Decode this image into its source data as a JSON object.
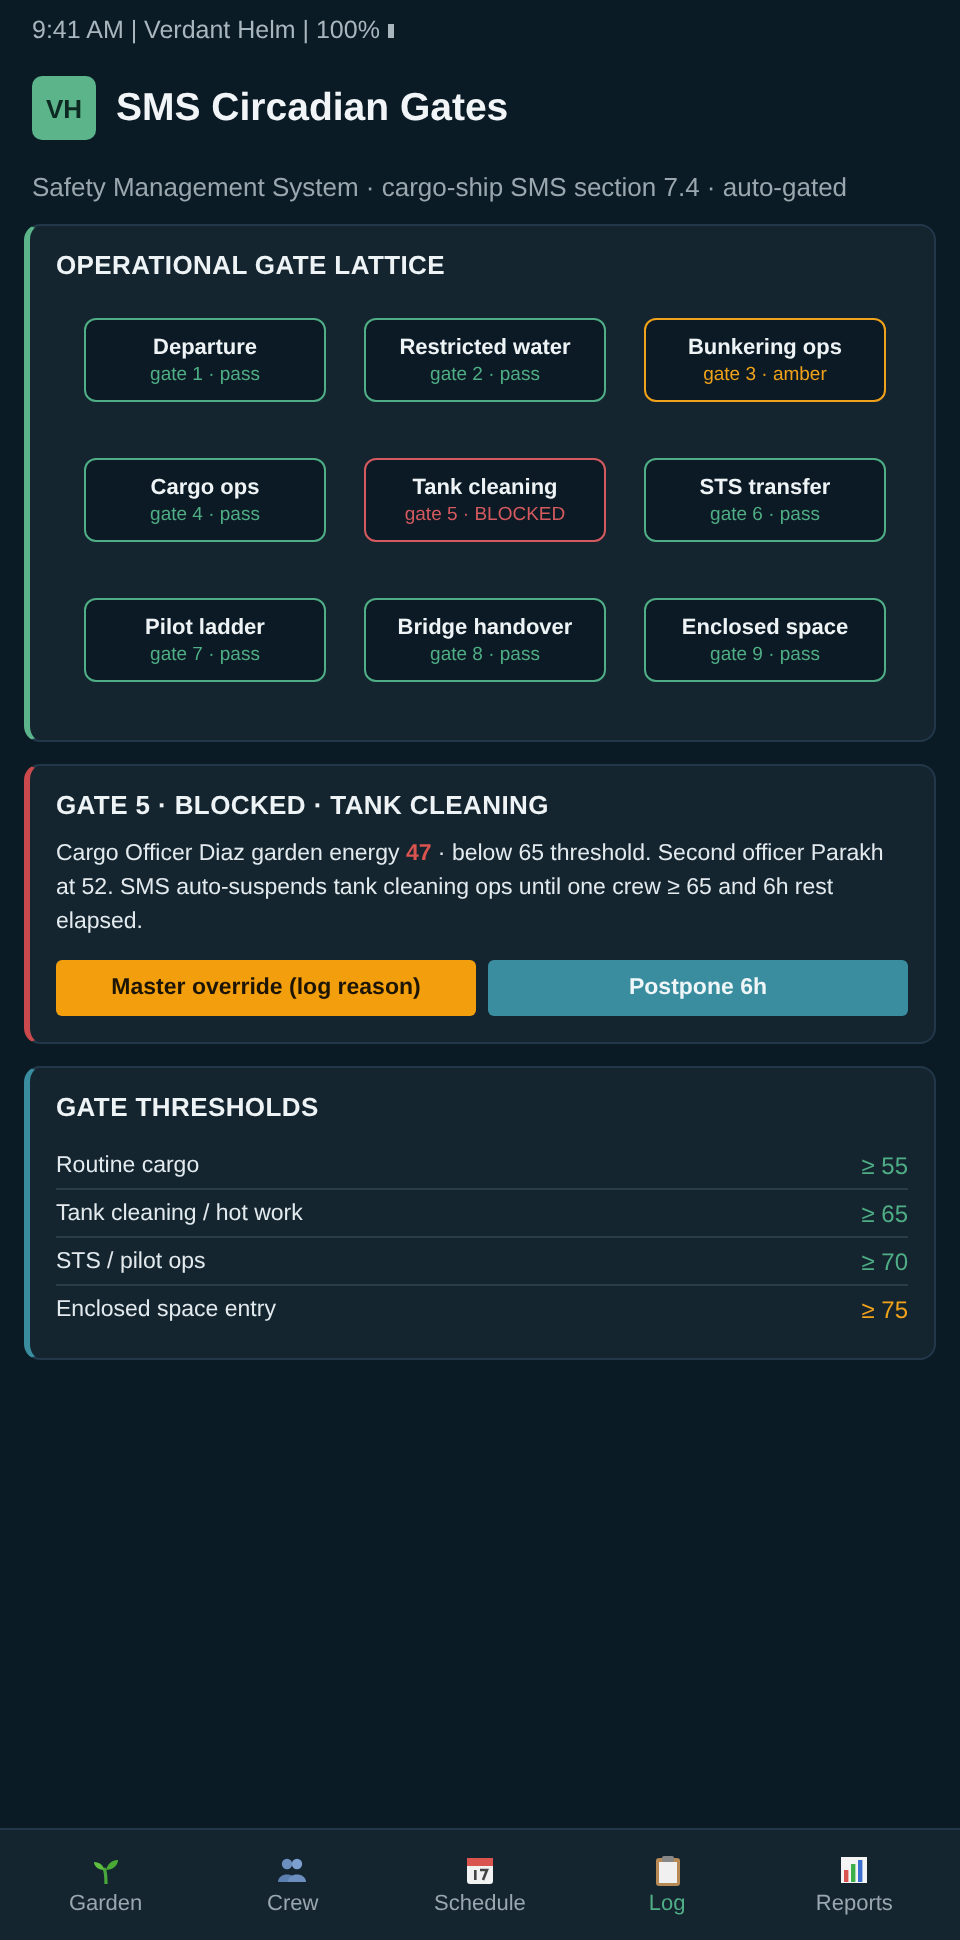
{
  "status_bar": {
    "text": "9:41 AM | Verdant Helm | 100%"
  },
  "header": {
    "logo": "VH",
    "title": "SMS Circadian Gates",
    "subtitle": "Safety Management System · cargo-ship SMS section 7.4 · auto-gated"
  },
  "lattice": {
    "title": "OPERATIONAL GATE LATTICE",
    "gates": [
      {
        "name": "Departure",
        "caption": "gate 1 · pass",
        "color": "#4fae85"
      },
      {
        "name": "Restricted water",
        "caption": "gate 2 · pass",
        "color": "#4fae85"
      },
      {
        "name": "Bunkering ops",
        "caption": "gate 3 · amber",
        "color": "#f0a21a"
      },
      {
        "name": "Cargo ops",
        "caption": "gate 4 · pass",
        "color": "#4fae85"
      },
      {
        "name": "Tank cleaning",
        "caption": "gate 5 · BLOCKED",
        "color": "#d45a5f"
      },
      {
        "name": "STS transfer",
        "caption": "gate 6 · pass",
        "color": "#4fae85"
      },
      {
        "name": "Pilot ladder",
        "caption": "gate 7 · pass",
        "color": "#4fae85"
      },
      {
        "name": "Bridge handover",
        "caption": "gate 8 · pass",
        "color": "#4fae85"
      },
      {
        "name": "Enclosed space",
        "caption": "gate 9 · pass",
        "color": "#4fae85"
      }
    ]
  },
  "alert": {
    "title": "GATE 5 · BLOCKED · TANK CLEANING",
    "body": "Cargo Officer Diaz garden energy **47** · below 65 threshold. Second officer Parakh at 52. SMS auto-suspends tank cleaning ops until one crew ≥ 65 and 6h rest elapsed.",
    "buttons": [
      {
        "label": "Master override (log reason)",
        "kind": "warning"
      },
      {
        "label": "Postpone 6h",
        "kind": "secondary"
      }
    ]
  },
  "thresholds": {
    "title": "GATE THRESHOLDS",
    "rows": [
      {
        "label": "Routine cargo",
        "value": "≥ 55",
        "color": "#4fae85"
      },
      {
        "label": "Tank cleaning / hot work",
        "value": "≥ 65",
        "color": "#4fae85"
      },
      {
        "label": "STS / pilot ops",
        "value": "≥ 70",
        "color": "#4fae85"
      },
      {
        "label": "Enclosed space entry",
        "value": "≥ 75",
        "color": "#f0a21a"
      }
    ]
  },
  "nav": [
    {
      "label": "Garden",
      "selected": false
    },
    {
      "label": "Crew",
      "selected": false
    },
    {
      "label": "Schedule",
      "selected": false
    },
    {
      "label": "Log",
      "selected": true
    },
    {
      "label": "Reports",
      "selected": false
    }
  ]
}
